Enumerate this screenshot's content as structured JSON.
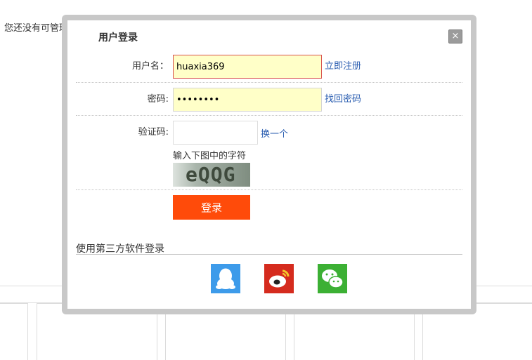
{
  "background": {
    "notice": "您还没有可管理"
  },
  "dialog": {
    "title": "用户登录",
    "close_label": "×",
    "username": {
      "label": "用户名：",
      "value": "huaxia369",
      "link": "立即注册"
    },
    "password": {
      "label": "密码:",
      "value": "••••••••",
      "link": "找回密码"
    },
    "captcha": {
      "label": "验证码:",
      "value": "",
      "refresh_link": "换一个",
      "hint": "输入下图中的字符",
      "image_text": "eQQG"
    },
    "login_button": "登录",
    "third_party": {
      "title": "使用第三方软件登录",
      "providers": [
        {
          "name": "QQ",
          "icon": "qq-icon",
          "color": "#3d9bea"
        },
        {
          "name": "Weibo",
          "icon": "weibo-icon",
          "color": "#d52b1e"
        },
        {
          "name": "WeChat",
          "icon": "wechat-icon",
          "color": "#3cb034"
        }
      ]
    }
  },
  "colors": {
    "accent_button": "#ff4b0a",
    "link": "#2a5db0",
    "input_highlight": "#ffffc8"
  }
}
